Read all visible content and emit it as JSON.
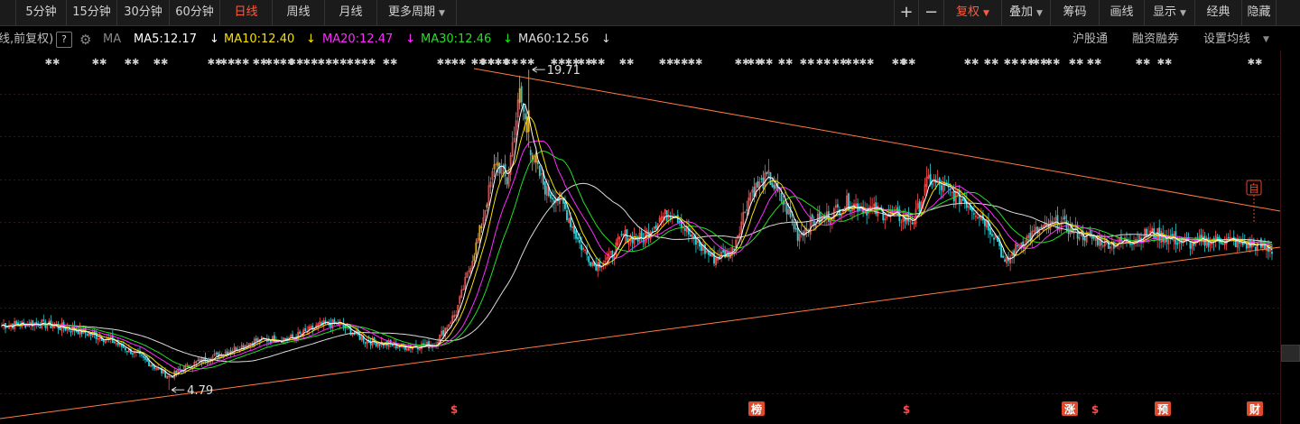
{
  "toolbar": {
    "left_items": [
      {
        "label": "5分钟",
        "active": false
      },
      {
        "label": "15分钟",
        "active": false
      },
      {
        "label": "30分钟",
        "active": false
      },
      {
        "label": "60分钟",
        "active": false
      },
      {
        "label": "日线",
        "active": true
      },
      {
        "label": "周线",
        "active": false
      },
      {
        "label": "月线",
        "active": false
      },
      {
        "label": "更多周期",
        "active": false,
        "dropdown": true
      }
    ],
    "zoom_in": "+",
    "zoom_out": "−",
    "right_items": [
      {
        "label": "复权",
        "active": true,
        "dropdown": true
      },
      {
        "label": "叠加",
        "active": false,
        "dropdown": true
      },
      {
        "label": "筹码",
        "active": false
      },
      {
        "label": "画线",
        "active": false
      },
      {
        "label": "显示",
        "active": false,
        "dropdown": true
      },
      {
        "label": "经典",
        "active": false
      },
      {
        "label": "隐藏",
        "active": false
      }
    ]
  },
  "ma_bar": {
    "mode_label": "线,前复权)",
    "help": "?",
    "ma_label": "MA",
    "ma5": "MA5:12.17",
    "ma10": "MA10:12.40",
    "ma20": "MA20:12.47",
    "ma30": "MA30:12.46",
    "ma60": "MA60:12.56",
    "arrow": "↓",
    "links": [
      "沪股通",
      "融资融券",
      "设置均线"
    ]
  },
  "colors": {
    "up": "#ff4d4d",
    "down": "#2ad0d8",
    "ma5": "#ffffff",
    "ma10": "#f5e000",
    "ma20": "#ff2bff",
    "ma30": "#22e022",
    "ma60": "#dcdcdc",
    "trendline": "#ff7a45",
    "accent": "#ff5a3c",
    "grid": "#2a1a1a"
  },
  "chart_data": {
    "type": "candlestick",
    "ylim": [
      3.2,
      20.6
    ],
    "high_label": "19.71",
    "low_label": "4.79",
    "markers": [
      "$",
      "榜",
      "$",
      "涨",
      "$",
      "预",
      "财"
    ],
    "self_marker": "自",
    "anchors": [
      [
        0,
        7.8
      ],
      [
        20,
        7.9
      ],
      [
        40,
        7.6
      ],
      [
        60,
        7.1
      ],
      [
        75,
        6.4
      ],
      [
        92,
        5.4
      ],
      [
        105,
        6.0
      ],
      [
        125,
        6.6
      ],
      [
        140,
        7.1
      ],
      [
        160,
        7.2
      ],
      [
        175,
        7.8
      ],
      [
        185,
        7.9
      ],
      [
        200,
        7.1
      ],
      [
        220,
        6.8
      ],
      [
        238,
        6.9
      ],
      [
        250,
        8.4
      ],
      [
        262,
        11.8
      ],
      [
        272,
        15.5
      ],
      [
        278,
        14.5
      ],
      [
        285,
        18.6
      ],
      [
        292,
        15.6
      ],
      [
        300,
        14.0
      ],
      [
        308,
        13.6
      ],
      [
        318,
        11.6
      ],
      [
        326,
        10.6
      ],
      [
        334,
        10.9
      ],
      [
        342,
        12.0
      ],
      [
        352,
        11.8
      ],
      [
        362,
        12.8
      ],
      [
        370,
        13.1
      ],
      [
        380,
        11.8
      ],
      [
        392,
        10.9
      ],
      [
        402,
        11.3
      ],
      [
        412,
        14.0
      ],
      [
        422,
        14.7
      ],
      [
        432,
        13.2
      ],
      [
        438,
        12.0
      ],
      [
        446,
        12.6
      ],
      [
        455,
        12.9
      ],
      [
        465,
        13.5
      ],
      [
        478,
        13.2
      ],
      [
        490,
        12.9
      ],
      [
        502,
        12.7
      ],
      [
        510,
        14.6
      ],
      [
        520,
        14.1
      ],
      [
        530,
        13.6
      ],
      [
        540,
        12.8
      ],
      [
        548,
        11.8
      ],
      [
        552,
        10.6
      ],
      [
        560,
        11.6
      ],
      [
        570,
        12.2
      ],
      [
        582,
        12.6
      ],
      [
        592,
        12.1
      ],
      [
        602,
        11.8
      ],
      [
        612,
        11.6
      ],
      [
        622,
        11.8
      ],
      [
        632,
        12.1
      ],
      [
        642,
        11.9
      ],
      [
        652,
        11.6
      ],
      [
        662,
        11.7
      ],
      [
        672,
        11.8
      ],
      [
        682,
        11.6
      ],
      [
        692,
        11.5
      ],
      [
        700,
        11.3
      ]
    ],
    "seed": 7
  }
}
